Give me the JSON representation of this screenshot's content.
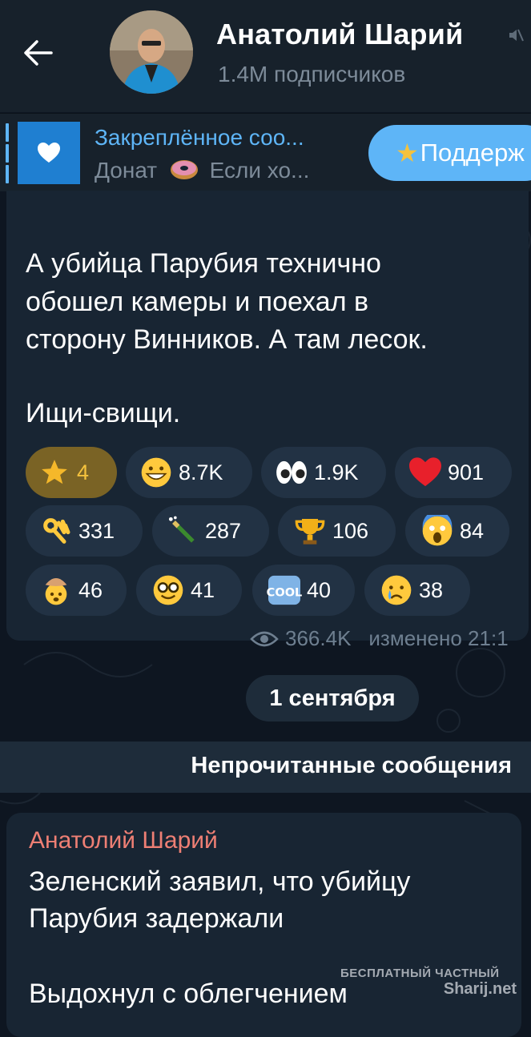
{
  "header": {
    "title": "Анатолий Шарий",
    "subtitle": "1.4M подписчиков",
    "back_icon": "arrow-left-icon",
    "mute_icon": "muted-icon"
  },
  "pinned": {
    "title": "Закреплённое соо...",
    "text_before": "Донат",
    "text_after": "Если хо...",
    "icon": "heart-icon",
    "support_label": "Поддерж"
  },
  "message1": {
    "lines": [
      "А убийца Парубия технично",
      "обошел камеры и  поехал в",
      "сторону Винников. А там лесок.",
      "Ищи-свищи."
    ],
    "reactions": [
      {
        "emoji": "star",
        "count": "4"
      },
      {
        "emoji": "grin",
        "count": "8.7K"
      },
      {
        "emoji": "eyes",
        "count": "1.9K"
      },
      {
        "emoji": "heart",
        "count": "901"
      },
      {
        "emoji": "ok-hand",
        "count": "331"
      },
      {
        "emoji": "champagne",
        "count": "287"
      },
      {
        "emoji": "trophy",
        "count": "106"
      },
      {
        "emoji": "scream",
        "count": "84"
      },
      {
        "emoji": "exploding-head",
        "count": "46"
      },
      {
        "emoji": "nerd",
        "count": "41"
      },
      {
        "emoji": "cool",
        "count": "40"
      },
      {
        "emoji": "crying",
        "count": "38"
      }
    ],
    "views": "366.4K",
    "edited": "изменено 21:1"
  },
  "date_separator": "1 сентября",
  "unread_label": "Непрочитанные сообщения",
  "message2": {
    "author": "Анатолий Шарий",
    "lines": [
      "Зеленский заявил, что убийцу",
      "Парубия задержали",
      "Выдохнул с облегчением"
    ]
  },
  "watermark": {
    "line1": "БЕСПЛАТНЫЙ ЧАСТНЫЙ",
    "line2": "Sharij.net"
  },
  "colors": {
    "background": "#0e1621",
    "header": "#17212b",
    "bubble": "#182533",
    "accent": "#5eb5f7",
    "author": "#ee7f74"
  }
}
